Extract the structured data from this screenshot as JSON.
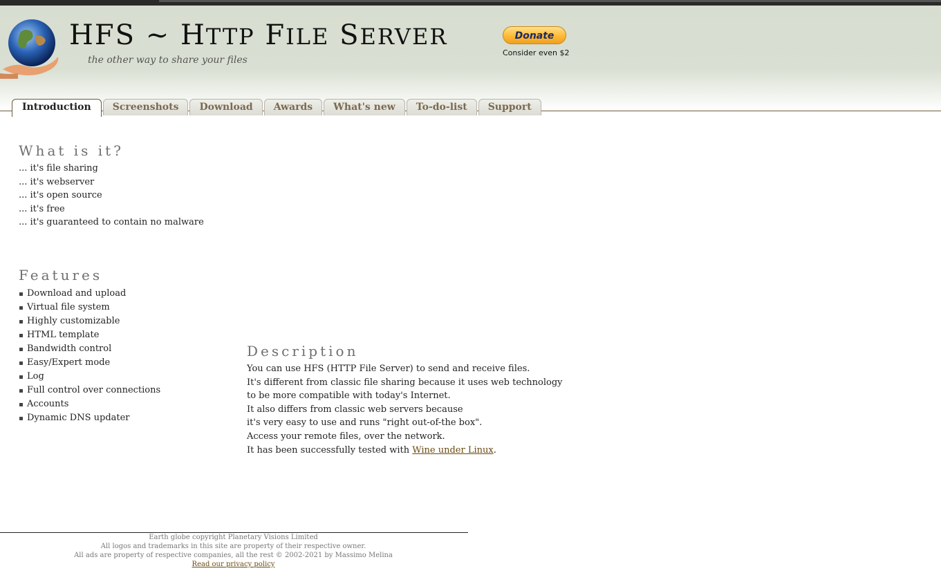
{
  "header": {
    "title_parts": [
      {
        "text": "HFS ~ H",
        "big": true
      },
      {
        "text": "TTP",
        "big": false
      },
      {
        "text": " F",
        "big": true
      },
      {
        "text": "ILE",
        "big": false
      },
      {
        "text": " S",
        "big": true
      },
      {
        "text": "ERVER",
        "big": false
      }
    ],
    "tagline": "the other way to share your files",
    "donate_label": "Donate",
    "donate_note": "Consider even $2"
  },
  "tabs": [
    {
      "label": "Introduction",
      "active": true
    },
    {
      "label": "Screenshots",
      "active": false
    },
    {
      "label": "Download",
      "active": false
    },
    {
      "label": "Awards",
      "active": false
    },
    {
      "label": "What's new",
      "active": false
    },
    {
      "label": "To-do-list",
      "active": false
    },
    {
      "label": "Support",
      "active": false
    }
  ],
  "what": {
    "heading": "What is it?",
    "items": [
      "... it's file sharing",
      "... it's webserver",
      "... it's open source",
      "... it's free",
      "... it's guaranteed to contain no malware"
    ]
  },
  "features": {
    "heading": "Features",
    "items": [
      "Download and upload",
      "Virtual file system",
      "Highly customizable",
      "HTML template",
      "Bandwidth control",
      "Easy/Expert mode",
      "Log",
      "Full control over connections",
      "Accounts",
      "Dynamic DNS updater"
    ]
  },
  "description": {
    "heading": "Description",
    "lines": [
      "You can use HFS (HTTP File Server) to send and receive files.",
      "It's different from classic file sharing because it uses web technology to be more compatible with today's Internet.",
      "It also differs from classic web servers because",
      "it's very easy to use and runs \"right out-of-the box\".",
      "Access your remote files, over the network."
    ],
    "last_line_prefix": "It has been successfully tested with ",
    "link_text": "Wine under Linux",
    "last_line_suffix": "."
  },
  "footer": {
    "line1": "Earth globe copyright Planetary Visions Limited",
    "line2": "All logos and trademarks in this site are property of their respective owner.",
    "line3": "All ads are property of respective companies, all the rest © 2002-2021 by Massimo Melina",
    "privacy_link": "Read our privacy policy"
  },
  "colors": {
    "header_bg": "#d7ddd0",
    "tab_text": "#7a6a50",
    "heading": "#6f6f6f",
    "link": "#6b4a10",
    "donate": "#ffb936"
  }
}
